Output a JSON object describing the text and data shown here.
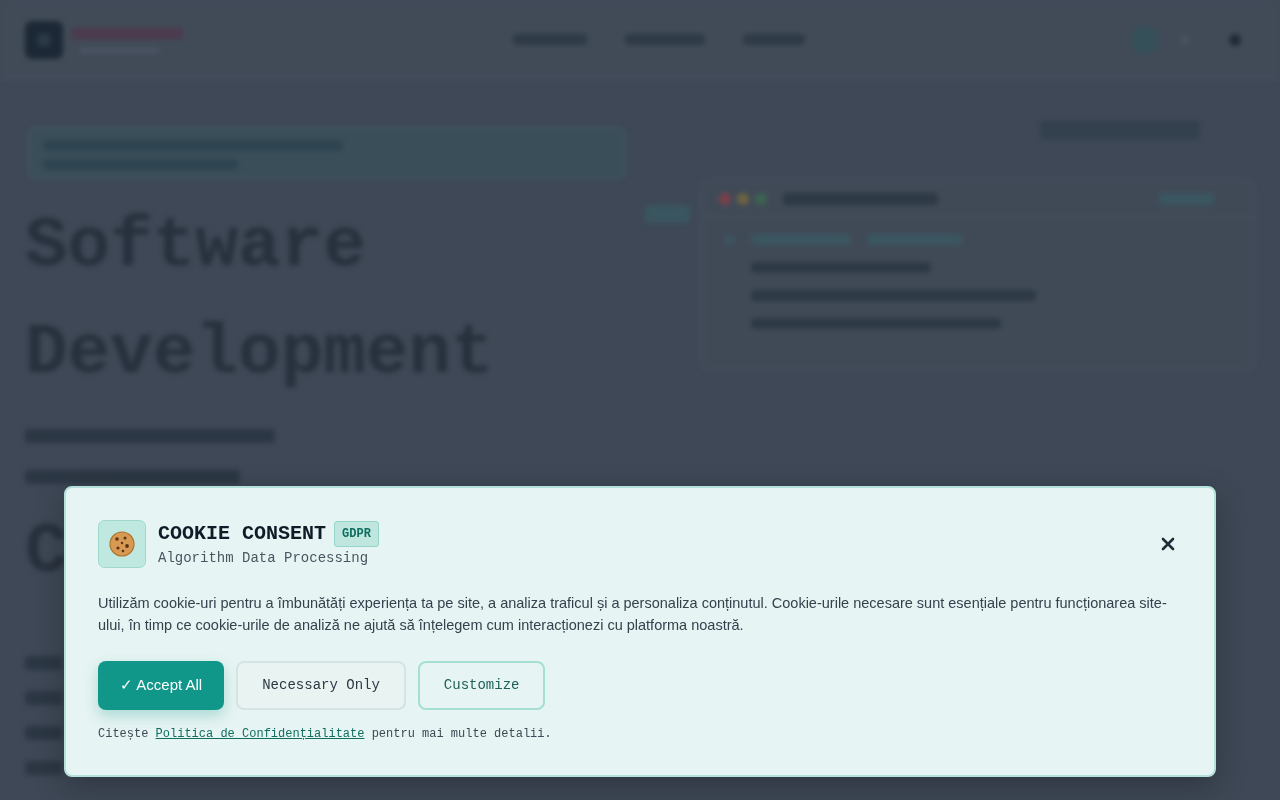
{
  "background_page": {
    "hero_title": "Software Development",
    "cut_heading": "C"
  },
  "cookie_consent": {
    "title": "COOKIE CONSENT",
    "badge": "GDPR",
    "subtitle": "Algorithm Data Processing",
    "message": "Utilizăm cookie-uri pentru a îmbunătăți experiența ta pe site, a analiza traficul și a personaliza conținutul. Cookie-urile necesare sunt esențiale pentru funcționarea site-ului, în timp ce cookie-urile de analiză ne ajută să înțelegem cum interacționezi cu platforma noastră.",
    "buttons": [
      {
        "label": "✓ Accept All",
        "kind": "primary"
      },
      {
        "label": "Necessary Only",
        "kind": "secondary"
      },
      {
        "label": "Customize",
        "kind": "outline"
      }
    ],
    "privacy_note": {
      "text_before": "Citește",
      "link": "Politica de Confidențialitate",
      "text_after": "pentru mai multe detalii."
    }
  }
}
